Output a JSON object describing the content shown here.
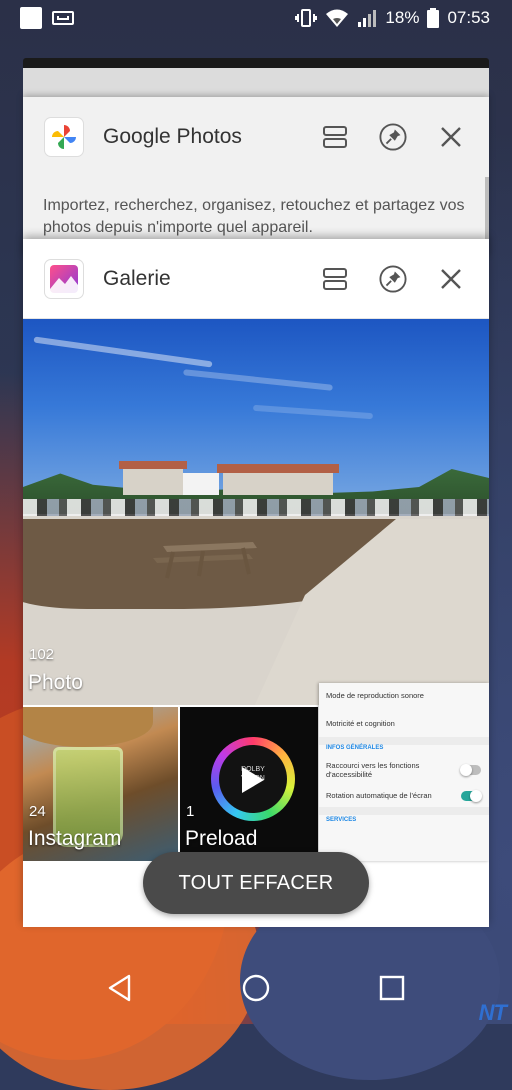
{
  "status_bar": {
    "battery": "18%",
    "time": "07:53"
  },
  "recents": {
    "google_photos": {
      "title": "Google Photos",
      "description": "Importez, recherchez, organisez, retouchez et partagez vos photos depuis n'importe quel appareil."
    },
    "galerie": {
      "title": "Galerie",
      "albums": [
        {
          "count": "102",
          "name": "Photo"
        },
        {
          "count": "24",
          "name": "Instagram"
        },
        {
          "count": "1",
          "name": "Preload"
        }
      ],
      "preload_logo_text": "DOLBY VISION",
      "settings_preview": {
        "row1": "Mode de reproduction sonore",
        "row2": "Motricité et cognition",
        "section1": "INFOS GÉNÉRALES",
        "row3": "Raccourci vers les fonctions d'accessibilité",
        "row4": "Rotation automatique de l'écran",
        "section2": "SERVICES",
        "toggle_accessibility_shortcut": false,
        "toggle_auto_rotate": true
      }
    },
    "clear_all_label": "TOUT EFFACER"
  },
  "watermark": "NT",
  "colors": {
    "accent_toggle": "#26a69a",
    "settings_section": "#1e88e5",
    "clear_button_bg": "#4a4a4a"
  },
  "icons": {
    "split": "split-screen-icon",
    "pin": "pin-icon",
    "close": "close-icon",
    "back": "back-triangle-icon",
    "home": "home-circle-icon",
    "recents": "recents-square-icon"
  }
}
